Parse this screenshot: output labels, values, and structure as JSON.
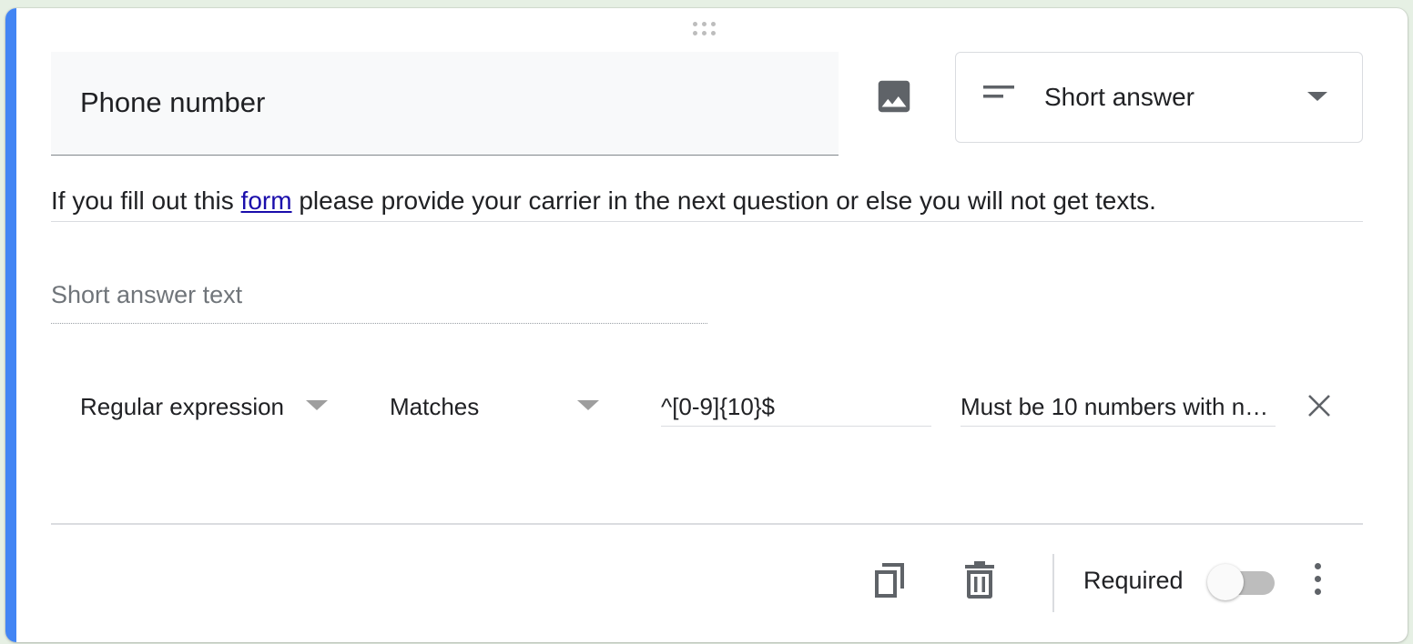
{
  "question": {
    "title": "Phone number",
    "type_label": "Short answer",
    "description_before": "If you fill out this ",
    "description_link": "form",
    "description_after": " please provide your carrier in the next question or else you will not get texts.",
    "answer_placeholder": "Short answer text"
  },
  "validation": {
    "type": "Regular expression",
    "condition": "Matches",
    "pattern": "^[0-9]{10}$",
    "error_text": "Must be 10 numbers with no…"
  },
  "footer": {
    "required_label": "Required",
    "required_on": false
  },
  "icons": {
    "drag": "drag-handle-icon",
    "image": "add-image-icon",
    "type": "short-answer-lines-icon",
    "remove": "close-icon",
    "duplicate": "duplicate-icon",
    "delete": "trash-icon",
    "more": "more-vert-icon"
  },
  "colors": {
    "accent": "#4285f4",
    "link": "#1a0dab"
  }
}
